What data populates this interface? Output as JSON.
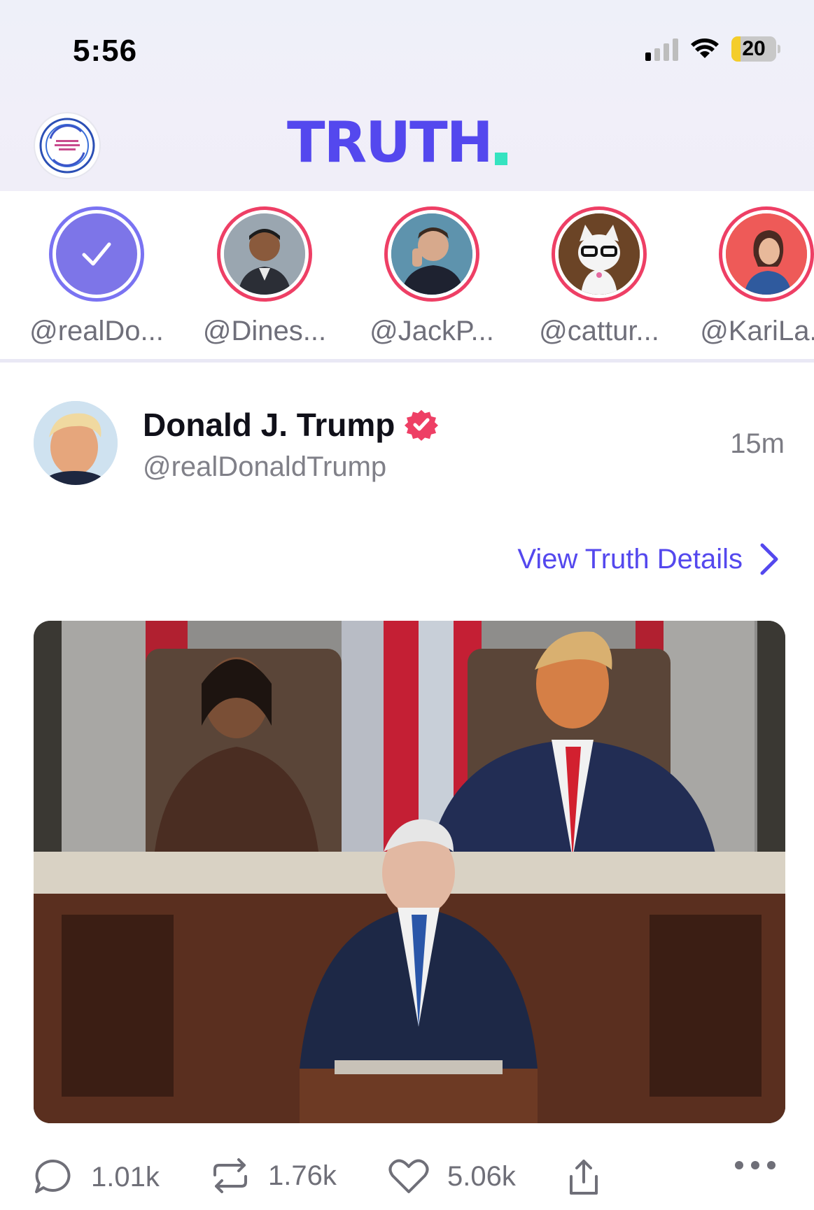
{
  "status_bar": {
    "time": "5:56",
    "battery": "20",
    "battery_level": 0.2,
    "signal_bars": 4,
    "signal_active": 1
  },
  "header": {
    "logo_text": "TRUTH",
    "brand_color": "#5448ee",
    "accent_color": "#35e3c0"
  },
  "stories": [
    {
      "handle": "@realDo...",
      "self": true
    },
    {
      "handle": "@Dines..."
    },
    {
      "handle": "@JackP..."
    },
    {
      "handle": "@cattur..."
    },
    {
      "handle": "@KariLa..."
    }
  ],
  "post": {
    "author_name": "Donald J. Trump",
    "verified": true,
    "handle": "@realDonaldTrump",
    "time": "15m",
    "details_link": "View Truth Details",
    "image_alt": "photo",
    "stats": {
      "replies": "1.01k",
      "retruths": "1.76k",
      "likes": "5.06k"
    }
  },
  "icons": [
    "check-icon",
    "verified-badge-icon",
    "chevron-right-icon",
    "reply-icon",
    "retruth-icon",
    "like-icon",
    "share-icon",
    "more-icon",
    "wifi-icon",
    "signal-icon",
    "battery-icon"
  ],
  "colors": {
    "story_ring": "#ee3f65",
    "self_story_ring": "#7a73f2",
    "verified": "#ee3f65"
  }
}
